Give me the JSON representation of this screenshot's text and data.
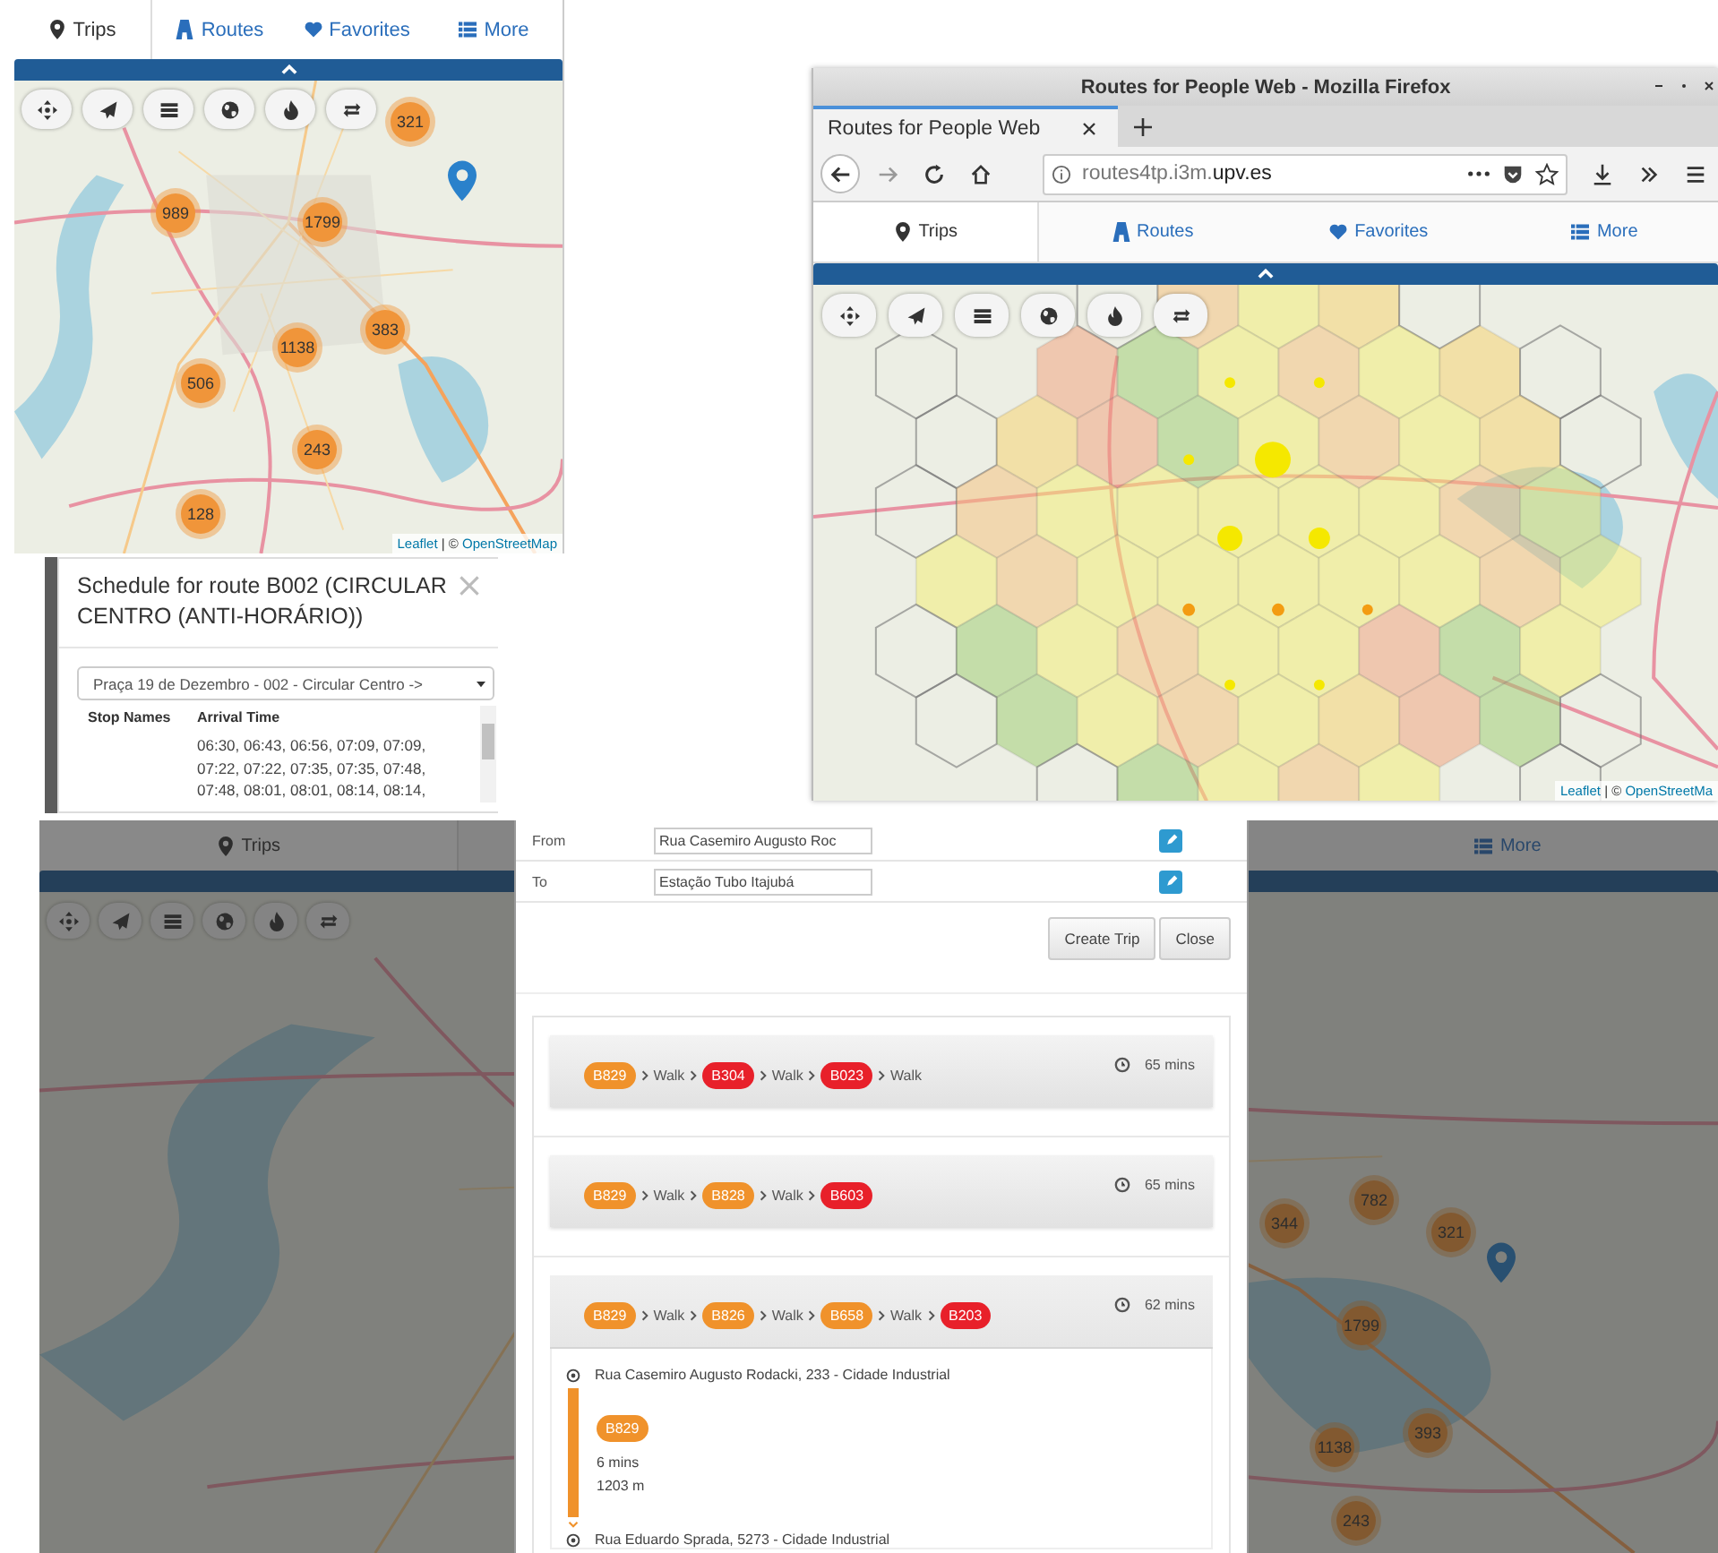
{
  "mobile_app": {
    "tabs": [
      {
        "label": "Trips",
        "selected": true
      },
      {
        "label": "Routes",
        "selected": false
      },
      {
        "label": "Favorites",
        "selected": false
      },
      {
        "label": "More",
        "selected": false
      }
    ],
    "map": {
      "clusters": [
        "321",
        "989",
        "1799",
        "383",
        "1138",
        "506",
        "243",
        "128"
      ],
      "attribution": {
        "link": "Leaflet",
        "separator": "| ©",
        "source": "OpenStreetMap"
      }
    }
  },
  "schedule_dialog": {
    "title": "Schedule for route B002 (CIRCULAR CENTRO (ANTI-HORÁRIO))",
    "direction_select": {
      "value": "Praça 19 de Dezembro - 002 - Circular Centro ->"
    },
    "columns": [
      "Stop Names",
      "Arrival Time"
    ],
    "rows": [
      {
        "arrival_times": "06:30, 06:43, 06:56, 07:09, 07:09, 07:22, 07:22, 07:35, 07:35, 07:48, 07:48, 08:01, 08:01, 08:14, 08:14,"
      }
    ]
  },
  "browser_window": {
    "title": "Routes for People Web - Mozilla Firefox",
    "tab_title": "Routes for People Web",
    "url": "routes4tp.i3m.**upv.es**",
    "app": {
      "tabs": [
        {
          "label": "Trips",
          "selected": true
        },
        {
          "label": "Routes",
          "selected": false
        },
        {
          "label": "Favorites",
          "selected": false
        },
        {
          "label": "More",
          "selected": false
        }
      ],
      "map": {
        "attribution": {
          "link": "Leaflet",
          "separator": "| ©",
          "source": "OpenStreetMa"
        }
      }
    }
  },
  "trip_planner": {
    "background_app": {
      "tabs": [
        {
          "label": "Trips",
          "selected": true
        },
        {
          "label": "More",
          "selected": false
        }
      ],
      "map": {
        "clusters": [
          "344",
          "782",
          "321",
          "1799",
          "1138",
          "393",
          "243"
        ]
      }
    },
    "dialog": {
      "fields": [
        {
          "label": "From",
          "value": "Rua Casemiro Augusto Roc"
        },
        {
          "label": "To",
          "value": "Estação Tubo Itajubá"
        }
      ],
      "buttons": [
        "Create Trip",
        "Close"
      ],
      "trips": [
        {
          "expanded": false,
          "duration": "65 mins",
          "legs": [
            {
              "kind": "bus",
              "label": "B829",
              "color": "#f0922b"
            },
            {
              "kind": "walk",
              "label": "Walk"
            },
            {
              "kind": "bus",
              "label": "B304",
              "color": "#e8202a"
            },
            {
              "kind": "walk",
              "label": "Walk"
            },
            {
              "kind": "bus",
              "label": "B023",
              "color": "#e8202a"
            },
            {
              "kind": "walk",
              "label": "Walk"
            }
          ]
        },
        {
          "expanded": false,
          "duration": "65 mins",
          "legs": [
            {
              "kind": "bus",
              "label": "B829",
              "color": "#f0922b"
            },
            {
              "kind": "walk",
              "label": "Walk"
            },
            {
              "kind": "bus",
              "label": "B828",
              "color": "#f0922b"
            },
            {
              "kind": "walk",
              "label": "Walk"
            },
            {
              "kind": "bus",
              "label": "B603",
              "color": "#e8202a"
            }
          ]
        },
        {
          "expanded": true,
          "duration": "62 mins",
          "legs": [
            {
              "kind": "bus",
              "label": "B829",
              "color": "#f0922b"
            },
            {
              "kind": "walk",
              "label": "Walk"
            },
            {
              "kind": "bus",
              "label": "B826",
              "color": "#f0922b"
            },
            {
              "kind": "walk",
              "label": "Walk"
            },
            {
              "kind": "bus",
              "label": "B658",
              "color": "#f0922b"
            },
            {
              "kind": "walk",
              "label": "Walk"
            },
            {
              "kind": "bus",
              "label": "B203",
              "color": "#e8202a"
            }
          ],
          "steps": [
            {
              "kind": "place",
              "text": "Rua Casemiro Augusto Rodacki, 233 - Cidade Industrial"
            },
            {
              "kind": "ride",
              "route": {
                "label": "B829",
                "color": "#f0922b"
              },
              "duration": "6 mins",
              "distance": "1203 m"
            },
            {
              "kind": "place",
              "text": "Rua Eduardo Sprada, 5273 - Cidade Industrial"
            }
          ]
        }
      ]
    }
  }
}
